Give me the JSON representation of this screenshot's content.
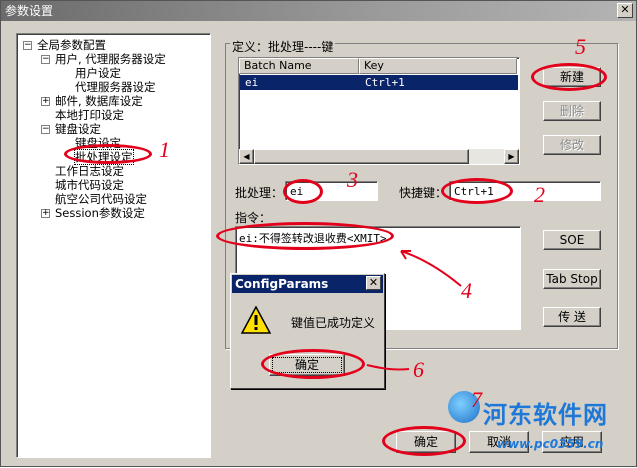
{
  "window": {
    "title": "参数设置",
    "close_glyph": "✕"
  },
  "tree": {
    "items": [
      {
        "label": "全局参数配置",
        "expander": "−"
      },
      {
        "label": "用户, 代理服务器设定",
        "expander": "−"
      },
      {
        "label": "用户设定"
      },
      {
        "label": "代理服务器设定"
      },
      {
        "label": "邮件, 数据库设定",
        "expander": "+"
      },
      {
        "label": "本地打印设定"
      },
      {
        "label": "键盘设定",
        "expander": "−"
      },
      {
        "label": "键盘设定"
      },
      {
        "label": "批处理设定",
        "selected": true
      },
      {
        "label": "工作日志设定"
      },
      {
        "label": "城市代码设定"
      },
      {
        "label": "航空公司代码设定"
      },
      {
        "label": "Session参数设定",
        "expander": "+"
      }
    ]
  },
  "group": {
    "title": "定义：批处理----键"
  },
  "table": {
    "columns": [
      "Batch Name",
      "Key"
    ],
    "rows": [
      {
        "batch": "ei",
        "key": "Ctrl+1"
      }
    ]
  },
  "buttons": {
    "new": "新建",
    "delete": "删除",
    "modify": "修改",
    "soe": "SOE",
    "tab_stop": "Tab Stop",
    "send": "传 送",
    "ok": "确定",
    "cancel": "取消",
    "apply": "应用"
  },
  "fields": {
    "batch_label": "批处理：",
    "batch_value": "ei",
    "hotkey_label": "快捷键：",
    "hotkey_value": "Ctrl+1",
    "command_label": "指令：",
    "command_value": "ei:不得签转改退收费<XMIT>"
  },
  "dialog": {
    "title": "ConfigParams",
    "message": "键值已成功定义",
    "ok": "确定",
    "close_glyph": "✕"
  },
  "annotations": [
    "1",
    "2",
    "3",
    "4",
    "5",
    "6",
    "7"
  ],
  "watermark": {
    "text": "河东软件网",
    "url": "www.pc0359.cn"
  }
}
